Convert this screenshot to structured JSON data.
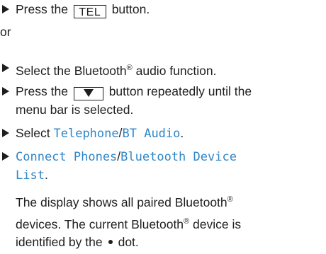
{
  "step1": {
    "pre": "Press the",
    "key": "TEL",
    "post": "button."
  },
  "or_text": "or",
  "step2": {
    "pre": "Select the Bluetooth",
    "reg": "®",
    "post": " audio function."
  },
  "step3": {
    "pre": "Press the",
    "post": "button repeatedly until the",
    "cont": "menu bar is selected.",
    "key_icon": "down-triangle-icon"
  },
  "step4": {
    "pre": "Select ",
    "menu1": "Telephone",
    "slash": "/",
    "menu2": "BT Audio",
    "end": "."
  },
  "step5": {
    "menu1": "Connect Phones",
    "slash": "/",
    "menu2": "Bluetooth Device",
    "menu3": "List",
    "end": "."
  },
  "desc": {
    "l1_pre": "The display shows all paired Bluetooth",
    "reg": "®",
    "l2_pre": "devices. The current Bluetooth",
    "l2_post": " device is",
    "l3_pre": "identified by the",
    "l3_post": "dot."
  }
}
